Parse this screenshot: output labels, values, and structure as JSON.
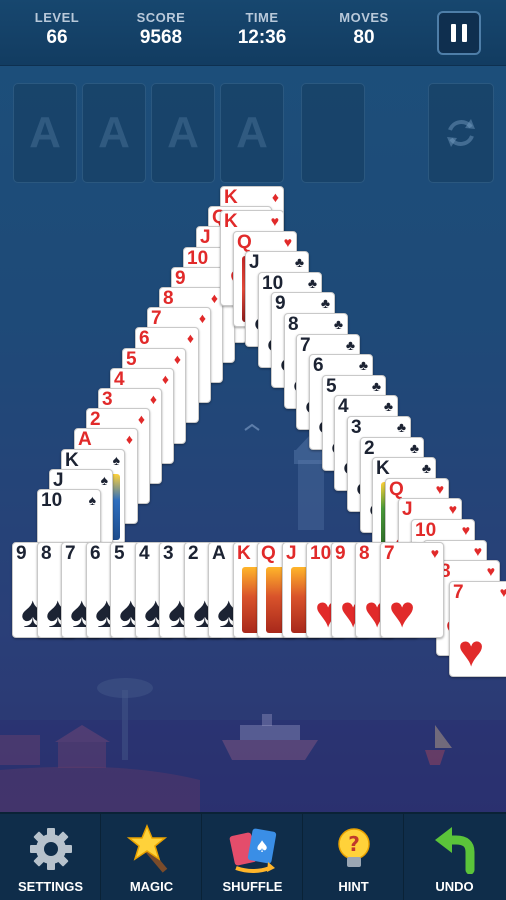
{
  "hud": {
    "stats": [
      {
        "label": "LEVEL",
        "value": "66"
      },
      {
        "label": "SCORE",
        "value": "9568"
      },
      {
        "label": "TIME",
        "value": "12:36"
      },
      {
        "label": "MOVES",
        "value": "80"
      }
    ]
  },
  "foundations": [
    "A",
    "A",
    "A",
    "A"
  ],
  "toolbar": {
    "settings": "SETTINGS",
    "magic": "MAGIC",
    "shuffle": "SHUFFLE",
    "hint": "HINT",
    "undo": "UNDO"
  },
  "colors": {
    "background": "#1e4a78",
    "hud": "#123c61",
    "toolbar": "#0f2d4a",
    "red_suit": "#e12a2a",
    "black_suit": "#1c2333"
  },
  "tableau": {
    "left_column": [
      "K♦",
      "Q♦",
      "J♦",
      "10♦",
      "9♦",
      "8♦",
      "7♦",
      "6♦",
      "5♦",
      "4♦",
      "3♦",
      "2♦",
      "A♦",
      "K♠",
      "J♠",
      "10♠"
    ],
    "right_column": [
      "K♥",
      "Q♥",
      "J♣",
      "10♣",
      "9♣",
      "8♣",
      "7♣",
      "6♣",
      "5♣",
      "4♣",
      "3♣",
      "2♣",
      "K♣",
      "Q♥",
      "J♥",
      "10♥",
      "9♥",
      "8♥",
      "7♥"
    ],
    "bottom_row": [
      "9♠",
      "8♠",
      "7♠",
      "6♠",
      "5♠",
      "4♠",
      "3♠",
      "2♠",
      "A♠",
      "K♦",
      "Q♦",
      "J♦",
      "10♥",
      "9♥",
      "8♥",
      "7♥"
    ]
  }
}
